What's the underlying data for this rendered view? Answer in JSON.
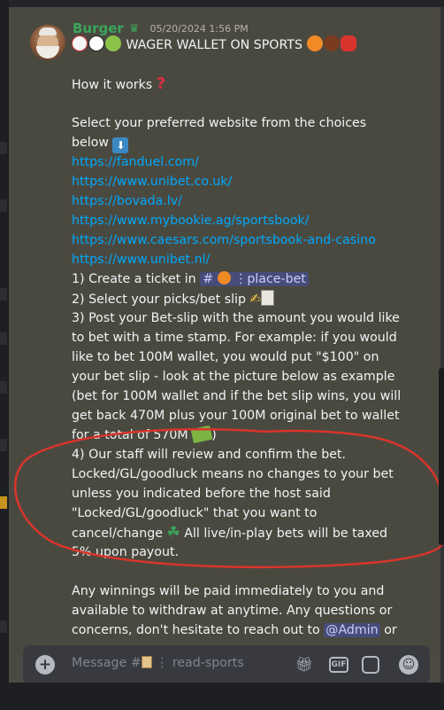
{
  "message": {
    "username": "Burger",
    "timestamp": "05/20/2024 1:56 PM",
    "title": "WAGER WALLET ON SPORTS",
    "how_it_works": "How it works",
    "select_line1": "Select your preferred website from the choices",
    "select_line2": "below",
    "links": [
      "https://fanduel.com/",
      "https://www.unibet.co.uk/",
      "https://bovada.lv/",
      "https://www.mybookie.ag/sportsbook/",
      "https://www.caesars.com/sportsbook-and-casino",
      "https://www.unibet.nl/"
    ],
    "step1_prefix": "1) Create a ticket in",
    "step1_channel": "place-bet",
    "step2": "2) Select your picks/bet slip",
    "step3_lines": [
      "3) Post your Bet-slip with the amount you would like",
      "to bet with a time stamp. For example: if you would",
      "like to bet 100M wallet, you would put \"$100\" on",
      "your bet slip - look at the picture below as example",
      "(bet for 100M wallet and if the bet slip wins, you will",
      "get back 470M plus your 100M original bet to wallet"
    ],
    "step3_last": "for a total of 570M",
    "step3_close": ")",
    "step4_lines": [
      "4) Our staff will review and confirm the bet.",
      "Locked/GL/goodluck means no changes to your bet",
      "unless you indicated before the host said",
      "\"Locked/GL/goodluck\" that you want to"
    ],
    "step4_cancel": "cancel/change",
    "step4_taxed": "All live/in-play bets will be taxed",
    "step4_last": "5% upon payout.",
    "winnings_lines": [
      "Any winnings will be paid immediately to you and",
      "available to withdraw at anytime. Any questions or",
      "concerns, don't hesitate to reach out to"
    ],
    "mention": "@Admin",
    "winnings_tail": "or"
  },
  "composer": {
    "placeholder_prefix": "Message #",
    "placeholder_channel": "read-sports",
    "icons": [
      "add-icon",
      "gift-icon",
      "gif-icon",
      "sticker-icon",
      "emoji-icon"
    ]
  },
  "colors": {
    "username": "#3ba55d",
    "link": "#00a8fc",
    "annotation": "#d9342b"
  }
}
